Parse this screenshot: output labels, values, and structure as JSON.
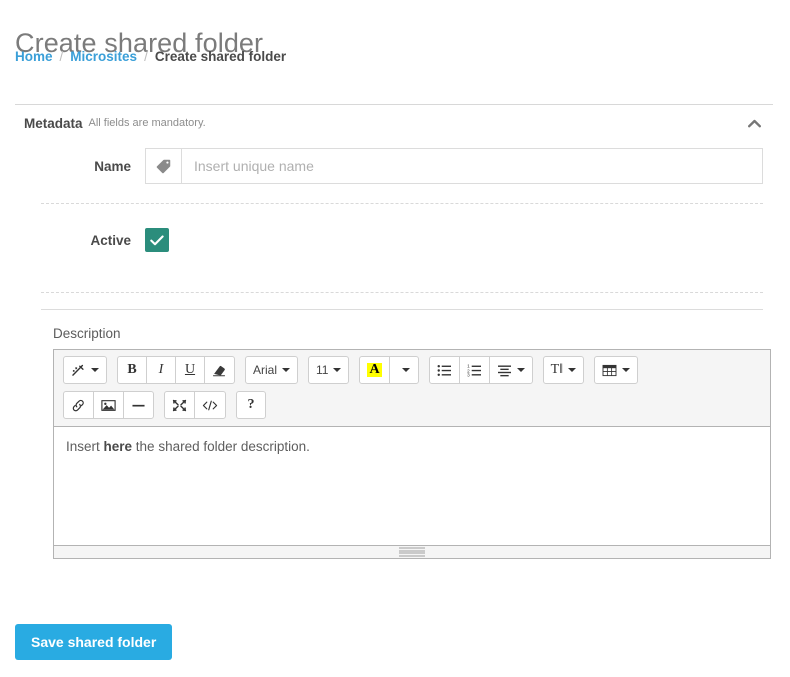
{
  "header": {
    "title": "Create shared folder",
    "breadcrumb": [
      {
        "label": "Home",
        "active": false
      },
      {
        "label": "Microsites",
        "active": false
      },
      {
        "label": "Create shared folder",
        "active": true
      }
    ],
    "separator": "/"
  },
  "panel": {
    "title": "Metadata",
    "subtitle": "All fields are mandatory.",
    "collapse_icon": "chevron-up-icon"
  },
  "form": {
    "name": {
      "label": "Name",
      "addon_icon": "tag-icon",
      "value": "",
      "placeholder": "Insert unique name"
    },
    "active": {
      "label": "Active",
      "checked": true,
      "check_icon": "check-icon",
      "color": "#2b8d7c"
    },
    "description": {
      "label": "Description",
      "content_prefix": "Insert ",
      "content_bold": "here",
      "content_suffix": " the shared folder description."
    }
  },
  "editor": {
    "toolbar_rows": [
      [
        [
          {
            "name": "style-icon",
            "glyph": "magic",
            "caret": true
          }
        ],
        [
          {
            "name": "bold-icon",
            "glyph": "B"
          },
          {
            "name": "italic-icon",
            "glyph": "I"
          },
          {
            "name": "underline-icon",
            "glyph": "U"
          },
          {
            "name": "clear-format-icon",
            "glyph": "eraser"
          }
        ],
        [
          {
            "name": "font-name-select",
            "glyph": "Arial",
            "caret": true,
            "sans": true
          }
        ],
        [
          {
            "name": "font-size-select",
            "glyph": "11",
            "caret": true,
            "sans": true
          }
        ],
        [
          {
            "name": "recent-color-icon",
            "glyph": "A-highlight"
          },
          {
            "name": "color-dropdown",
            "glyph": "",
            "caret": true
          }
        ],
        [
          {
            "name": "unordered-list-icon",
            "glyph": "ul"
          },
          {
            "name": "ordered-list-icon",
            "glyph": "ol"
          },
          {
            "name": "paragraph-align-icon",
            "glyph": "align",
            "caret": true
          }
        ],
        [
          {
            "name": "line-height-icon",
            "glyph": "TI",
            "caret": true
          }
        ],
        [
          {
            "name": "table-icon",
            "glyph": "table",
            "caret": true
          }
        ]
      ],
      [
        [
          {
            "name": "link-icon",
            "glyph": "link"
          },
          {
            "name": "picture-icon",
            "glyph": "picture"
          },
          {
            "name": "horizontal-rule-icon",
            "glyph": "hr"
          }
        ],
        [
          {
            "name": "fullscreen-icon",
            "glyph": "fullscreen"
          },
          {
            "name": "code-view-icon",
            "glyph": "code"
          }
        ],
        [
          {
            "name": "help-icon",
            "glyph": "?"
          }
        ]
      ]
    ]
  },
  "actions": {
    "save_label": "Save shared folder",
    "save_color": "#29abe2"
  }
}
